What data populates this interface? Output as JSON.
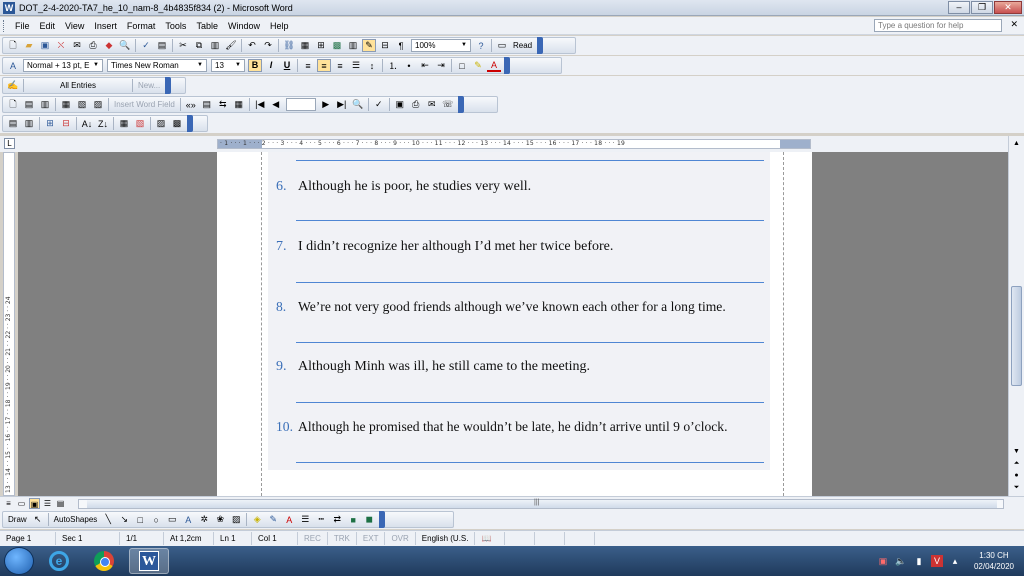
{
  "window": {
    "title": "DOT_2-4-2020-TA7_he_10_nam-8_4b4835f834 (2) - Microsoft Word",
    "app_icon_letter": "W",
    "minimize_glyph": "–",
    "restore_glyph": "❐",
    "close_glyph": "✕"
  },
  "menu": {
    "items": [
      "File",
      "Edit",
      "View",
      "Insert",
      "Format",
      "Tools",
      "Table",
      "Window",
      "Help"
    ],
    "help_placeholder": "Type a question for help",
    "close_glyph": "✕"
  },
  "standard_toolbar": {
    "zoom": "100%",
    "read_label": "Read"
  },
  "formatting_toolbar": {
    "style": "Normal + 13 pt, E",
    "font": "Times New Roman",
    "size": "13",
    "bold": "B",
    "italic": "I",
    "underline": "U",
    "font_color_letter": "A"
  },
  "autotext_toolbar": {
    "all_entries": "All Entries",
    "new_label": "New..."
  },
  "mailmerge_toolbar": {
    "insert_word_field": "Insert Word Field"
  },
  "ruler": {
    "corner": "L",
    "h_ticks": "· 1 · · · 1 · · · 2 · · · 3 · · · 4 · · · 5 · · · 6 · · · 7 · · · 8 · · · 9 · · · 10 · · · 11 · · · 12 · · · 13 · · · 14 · · · 15 · · · 16 · · · 17 · · · 18 · · · 19",
    "v_ticks": "13 · · 14 · · 15 · · 16 · · 17 · · 18 · · 19 · · 20 · · 21 · · 22 · · 23 · · 24"
  },
  "document": {
    "questions": [
      {
        "num": "6.",
        "text": "Although he is poor, he studies very well."
      },
      {
        "num": "7.",
        "text": "I didn’t recognize her although I’d met her twice before."
      },
      {
        "num": "8.",
        "text": "We’re not very good friends although we’ve known each other for a long time."
      },
      {
        "num": "9.",
        "text": "Although Minh was ill, he still came to the meeting."
      },
      {
        "num": "10.",
        "text": "Although he promised that he wouldn’t be late, he didn’t arrive until 9 o’clock."
      }
    ]
  },
  "drawing_toolbar": {
    "draw": "Draw",
    "autoshapes": "AutoShapes"
  },
  "statusbar": {
    "page": "Page 1",
    "sec": "Sec 1",
    "pages": "1/1",
    "at": "At 1,2cm",
    "ln": "Ln 1",
    "col": "Col 1",
    "rec": "REC",
    "trk": "TRK",
    "ext": "EXT",
    "ovr": "OVR",
    "language": "English (U.S."
  },
  "taskbar": {
    "time": "1:30 CH",
    "date": "02/04/2020"
  },
  "colors": {
    "question_number": "#3a6fb8",
    "answer_line": "#4f86d3",
    "workspace": "#808080"
  }
}
